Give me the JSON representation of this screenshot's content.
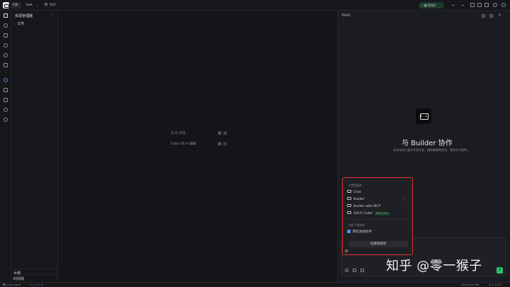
{
  "titlebar": {
    "ide_chip": "IDE",
    "project_name": "test",
    "search_placeholder": "搜索",
    "mode_badge": "• 编 SOLO"
  },
  "sidebar": {
    "title": "资源管理器",
    "more": "···",
    "folder_label": "文件",
    "outline_label": "大纲",
    "timeline_label": "时间线"
  },
  "editor": {
    "shortcuts": [
      {
        "label": "与 AI 对话",
        "keys": [
          "⌘",
          "U"
        ]
      },
      {
        "label": "Editor 的 AI 编辑",
        "keys": [
          "⌘",
          "I"
        ]
      }
    ]
  },
  "right_panel": {
    "title": "TRAE",
    "heading": "与 Builder 协作",
    "subtitle": "自动化执行复杂开发任务，编排编辑和完成，提高交付效率。"
  },
  "agent_menu": {
    "section_builtin": "内置智能体",
    "items": [
      {
        "label": "Chat",
        "selected": false
      },
      {
        "label": "Builder",
        "selected": true
      },
      {
        "label": "Builder with MCP",
        "selected": false
      },
      {
        "label": "SOLO Coder",
        "selected": false,
        "badge": "SOLO Only"
      }
    ],
    "section_custom": "自定义智能体",
    "custom_items": [
      {
        "label": "网页测试助手"
      }
    ],
    "create_button": "创建智能体",
    "selected_mark": "✓"
  },
  "chat": {
    "send_icon": "↑",
    "watermark": "知乎 @零一猴子"
  },
  "statusbar": {
    "left_launch": "Launchpad",
    "left_counts": "0 △ 0 ⚠ 0",
    "right_continue": "Continue Edit",
    "right_items": "⊘ 1 ◷ 0.0"
  },
  "colors": {
    "accent_green": "#2fbf6b",
    "highlight_red": "#e0332b",
    "background": "#16171b"
  }
}
